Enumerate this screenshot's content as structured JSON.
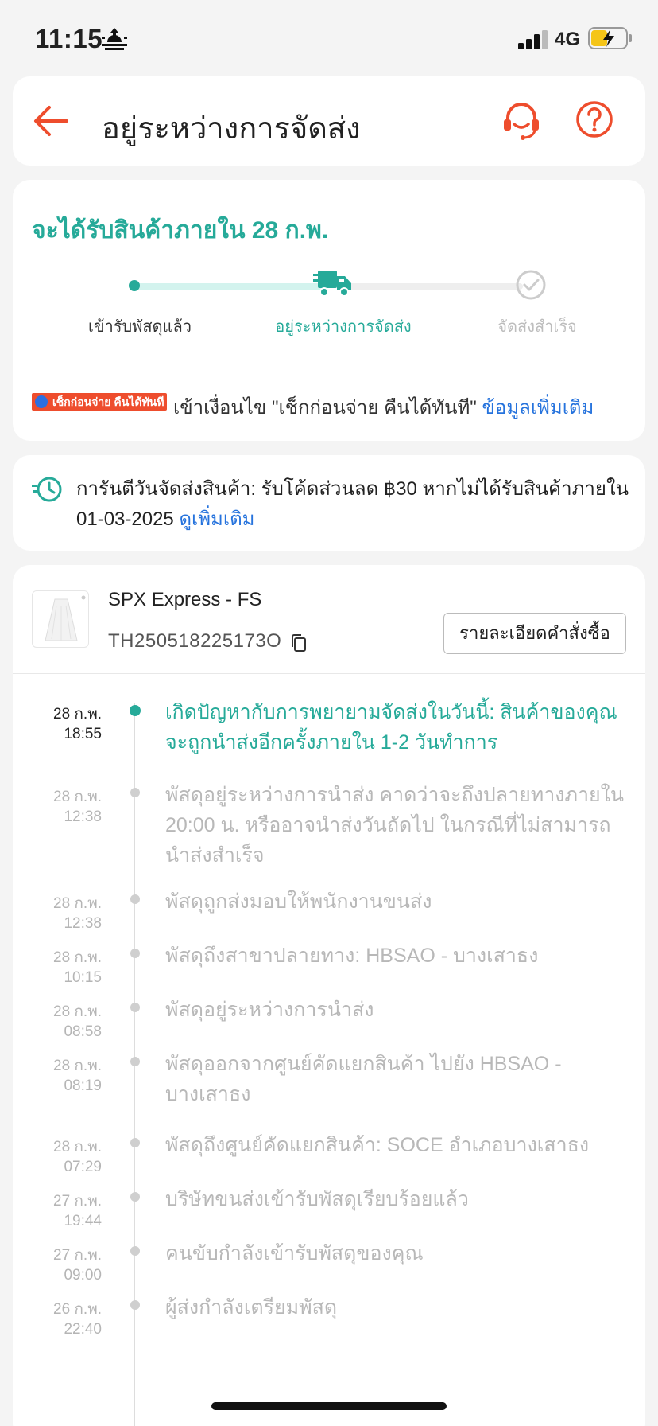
{
  "status_bar": {
    "time": "11:15",
    "network": "4G"
  },
  "header": {
    "title": "อยู่ระหว่างการจัดส่ง"
  },
  "progress": {
    "eta": "จะได้รับสินค้าภายใน 28 ก.พ.",
    "steps": [
      "เข้ารับพัสดุแล้ว",
      "อยู่ระหว่างการจัดส่ง",
      "จัดส่งสำเร็จ"
    ],
    "current_step": 2,
    "badge": "เช็กก่อนจ่าย คืนได้ทันที",
    "check_text": "เข้าเงื่อนไข \"เช็กก่อนจ่าย คืนได้ทันที\"",
    "check_link": "ข้อมูลเพิ่มเติม"
  },
  "guarantee": {
    "text": "การันตีวันจัดส่งสินค้า: รับโค้ดส่วนลด ฿30 หากไม่ได้รับสินค้าภายใน 01-03-2025",
    "link": "ดูเพิ่มเติม"
  },
  "shipment": {
    "carrier": "SPX Express - FS",
    "tracking_number": "TH250518225173O",
    "order_details_label": "รายละเอียดคำสั่งซื้อ"
  },
  "timeline": [
    {
      "date": "28 ก.พ.",
      "time": "18:55",
      "text": "เกิดปัญหากับการพยายามจัดส่งในวันนี้: สินค้าของคุณจะถูกนำส่งอีกครั้งภายใน 1-2 วันทำการ",
      "active": true
    },
    {
      "date": "28 ก.พ.",
      "time": "12:38",
      "text": "พัสดุอยู่ระหว่างการนำส่ง คาดว่าจะถึงปลายทางภายใน 20:00 น. หรืออาจนำส่งวันถัดไป ในกรณีที่ไม่สามารถนำส่งสำเร็จ",
      "active": false
    },
    {
      "date": "28 ก.พ.",
      "time": "12:38",
      "text": "พัสดุถูกส่งมอบให้พนักงานขนส่ง",
      "active": false
    },
    {
      "date": "28 ก.พ.",
      "time": "10:15",
      "text": "พัสดุถึงสาขาปลายทาง: HBSAO - บางเสาธง",
      "active": false
    },
    {
      "date": "28 ก.พ.",
      "time": "08:58",
      "text": "พัสดุอยู่ระหว่างการนำส่ง",
      "active": false
    },
    {
      "date": "28 ก.พ.",
      "time": "08:19",
      "text": "พัสดุออกจากศูนย์คัดแยกสินค้า ไปยัง HBSAO - บางเสาธง",
      "active": false
    },
    {
      "date": "28 ก.พ.",
      "time": "07:29",
      "text": "พัสดุถึงศูนย์คัดแยกสินค้า: SOCE อำเภอบางเสาธง",
      "active": false
    },
    {
      "date": "27 ก.พ.",
      "time": "19:44",
      "text": "บริษัทขนส่งเข้ารับพัสดุเรียบร้อยแล้ว",
      "active": false
    },
    {
      "date": "27 ก.พ.",
      "time": "09:00",
      "text": "คนขับกำลังเข้ารับพัสดุของคุณ",
      "active": false
    },
    {
      "date": "26 ก.พ.",
      "time": "22:40",
      "text": "ผู้ส่งกำลังเตรียมพัสดุ",
      "active": false
    }
  ],
  "colors": {
    "brand": "#ee4d2d",
    "teal": "#26aa99",
    "link": "#2673dd"
  },
  "icons": [
    "back-arrow-icon",
    "headset-icon",
    "help-icon",
    "truck-icon",
    "check-circle-icon",
    "clock-icon",
    "copy-icon"
  ]
}
